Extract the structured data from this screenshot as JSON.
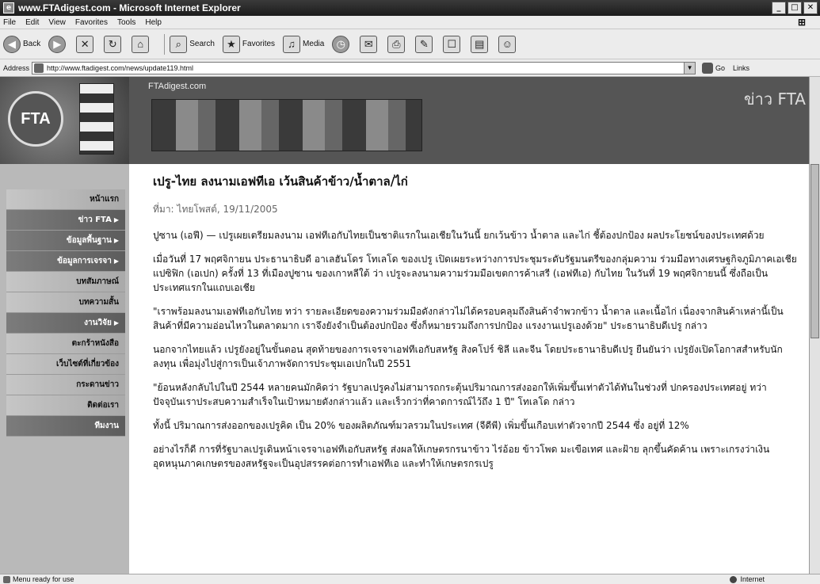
{
  "window": {
    "title": "www.FTAdigest.com - Microsoft Internet Explorer"
  },
  "menu": [
    "File",
    "Edit",
    "View",
    "Favorites",
    "Tools",
    "Help"
  ],
  "toolbar": {
    "back": "Back",
    "search": "Search",
    "favorites": "Favorites",
    "media": "Media"
  },
  "address": {
    "label": "Address",
    "url": "http://www.ftadigest.com/news/update119.html",
    "go": "Go",
    "links": "Links"
  },
  "banner": {
    "site": "FTAdigest.com",
    "section": "ข่าว FTA"
  },
  "nav": [
    {
      "label": "หน้าแรก",
      "dark": false,
      "arrow": false
    },
    {
      "label": "ข่าว FTA",
      "dark": true,
      "arrow": true
    },
    {
      "label": "ข้อมูลพื้นฐาน",
      "dark": true,
      "arrow": true
    },
    {
      "label": "ข้อมูลการเจรจา",
      "dark": true,
      "arrow": true
    },
    {
      "label": "บทสัมภาษณ์",
      "dark": false,
      "arrow": false
    },
    {
      "label": "บทความสั้น",
      "dark": false,
      "arrow": false
    },
    {
      "label": "งานวิจัย",
      "dark": true,
      "arrow": true
    },
    {
      "label": "ตะกร้าหนังสือ",
      "dark": false,
      "arrow": false
    },
    {
      "label": "เว็บไซต์ที่เกี่ยวข้อง",
      "dark": false,
      "arrow": false
    },
    {
      "label": "กระดานข่าว",
      "dark": false,
      "arrow": false
    },
    {
      "label": "ติดต่อเรา",
      "dark": false,
      "arrow": false
    },
    {
      "label": "ทีมงาน",
      "dark": true,
      "arrow": false
    }
  ],
  "article": {
    "title": "เปรู-ไทย ลงนามเอฟทีเอ เว้นสินค้าข้าว/น้ำตาล/ไก่",
    "date": "ที่มา: ไทยโพสต์, 19/11/2005",
    "paragraphs": [
      "ปูซาน (เอฟี) — เปรูเผยเตรียมลงนาม เอฟทีเอกับไทยเป็นชาติแรกในเอเชียในวันนี้ ยกเว้นข้าว น้ำตาล และไก่ ชี้ต้องปกป้อง ผลประโยชน์ของประเทศด้วย",
      "เมื่อวันที่ 17 พฤศจิกายน ประธานาธิบดี อาเลฮันโดร โทเลโด ของเปรู เปิดเผยระหว่างการประชุมระดับรัฐมนตรีของกลุ่มความ ร่วมมือทางเศรษฐกิจภูมิภาคเอเชียแปซิฟิก (เอเปก) ครั้งที่ 13 ที่เมืองปูซาน ของเกาหลีใต้ ว่า เปรูจะลงนามความร่วมมือเขตการค้าเสรี (เอฟทีเอ) กับไทย ในวันที่ 19 พฤศจิกายนนี้ ซึ่งถือเป็นประเทศแรกในแถบเอเชีย",
      "\"เราพร้อมลงนามเอฟทีเอกับไทย ทว่า รายละเอียดของความร่วมมือดังกล่าวไม่ได้ครอบคลุมถึงสินค้าจำพวกข้าว น้ำตาล และเนื้อไก่ เนื่องจากสินค้าเหล่านี้เป็นสินค้าที่มีความอ่อนไหวในตลาดมาก เราจึงยังจำเป็นต้องปกป้อง ซึ่งก็หมายรวมถึงการปกป้อง แรงงานเปรูเองด้วย\" ประธานาธิบดีเปรู กล่าว",
      "นอกจากไทยแล้ว เปรูยังอยู่ในขั้นตอน สุดท้ายของการเจรจาเอฟทีเอกับสหรัฐ สิงคโปร์ ชิลี และจีน โดยประธานาธิบดีเปรู ยืนยันว่า เปรูยังเปิดโอกาสสำหรับนักลงทุน เพื่อมุ่งไปสู่การเป็นเจ้าภาพจัดการประชุมเอเปกในปี 2551",
      "\"ย้อนหลังกลับไปในปี 2544 หลายคนมักคิดว่า รัฐบาลเปรูคงไม่สามารถกระตุ้นปริมาณการส่งออกให้เพิ่มขึ้นเท่าตัวได้ทันในช่วงที่ ปกครองประเทศอยู่ ทว่า ปัจจุบันเราประสบความสำเร็จในเป้าหมายดังกล่าวแล้ว และเร็วกว่าที่คาดการณ์ไว้ถึง 1 ปี\" โทเลโด กล่าว",
      "ทั้งนี้ ปริมาณการส่งออกของเปรูคิด เป็น 20% ของผลิตภัณฑ์มวลรวมในประเทศ (จีดีพี) เพิ่มขึ้นเกือบเท่าตัวจากปี 2544 ซึ่ง อยู่ที่ 12%",
      "อย่างไรก็ดี การที่รัฐบาลเปรูเดินหน้าเจรจาเอฟทีเอกับสหรัฐ ส่งผลให้เกษตรกรนาข้าว ไร่อ้อย ข้าวโพด มะเขือเทศ และฝ้าย ลุกขึ้นคัดค้าน เพราะเกรงว่าเงินอุดหนุนภาคเกษตรของสหรัฐจะเป็นอุปสรรคต่อการทำเอฟทีเอ และทำให้เกษตรกรเปรู"
    ]
  },
  "status": {
    "message": "Menu ready for use",
    "zone": "Internet"
  }
}
